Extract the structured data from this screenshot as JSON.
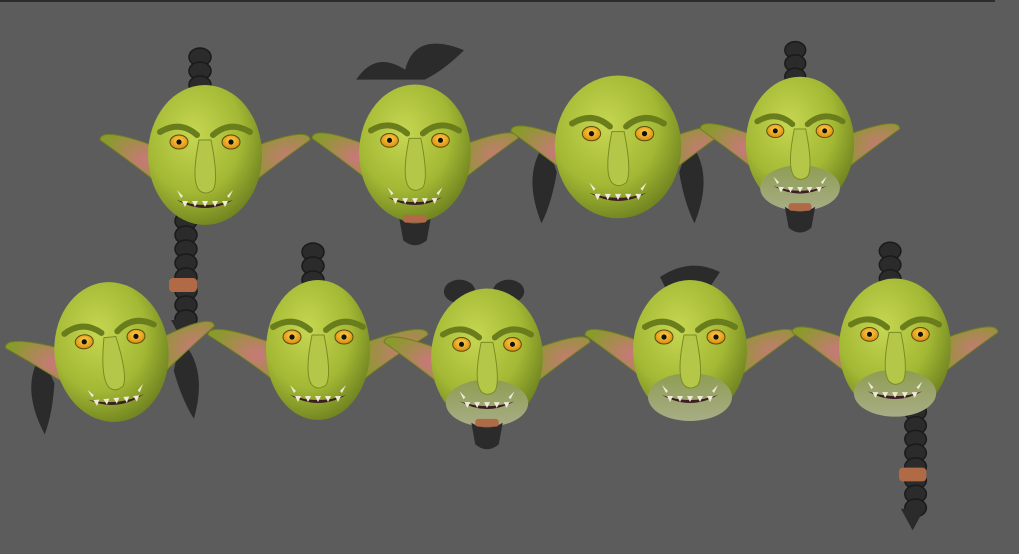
{
  "viewport": {
    "background": "#5c5c5c",
    "palette": {
      "skin": "#a9be3a",
      "skin_shadow": "#6f8420",
      "skin_highlight": "#c9d95a",
      "ear_inner": "#c0706a",
      "hair": "#2b2b2b",
      "band": "#b06a45",
      "eye": "#f2b21a",
      "pupil": "#111111",
      "mouth": "#3a1e22",
      "tooth": "#efe9d8",
      "chin_pale": "#9aa37a"
    }
  },
  "heads": [
    {
      "id": "goblin-1",
      "variant": "mohawk-braid",
      "hair": "mohawk",
      "beard": "long-braid",
      "shape": "round"
    },
    {
      "id": "goblin-2",
      "variant": "twin-topknot",
      "hair": "topknot",
      "beard": "short-tuft",
      "shape": "round"
    },
    {
      "id": "goblin-3",
      "variant": "bald-sideburns",
      "hair": "bald",
      "sideburns": true,
      "shape": "wide"
    },
    {
      "id": "goblin-4",
      "variant": "mohawk-pale-chin",
      "hair": "mohawk",
      "beard": "short-tuft",
      "pale_chin": true,
      "shape": "round"
    },
    {
      "id": "goblin-5",
      "variant": "bald-sideburns-side",
      "hair": "bald",
      "sideburns": true,
      "shape": "tilted"
    },
    {
      "id": "goblin-6",
      "variant": "mohawk-clean",
      "hair": "mohawk",
      "beard": "none",
      "shape": "narrow"
    },
    {
      "id": "goblin-7",
      "variant": "twin-buns-tuft",
      "hair": "twin-buns",
      "beard": "short-tuft",
      "pale_chin": true,
      "shape": "round"
    },
    {
      "id": "goblin-8",
      "variant": "ponytail-clean",
      "hair": "ponytail",
      "beard": "none",
      "pale_chin": true,
      "shape": "round"
    },
    {
      "id": "goblin-9",
      "variant": "mohawk-long-braid",
      "hair": "mohawk",
      "beard": "long-braid",
      "pale_chin": true,
      "shape": "round"
    }
  ]
}
